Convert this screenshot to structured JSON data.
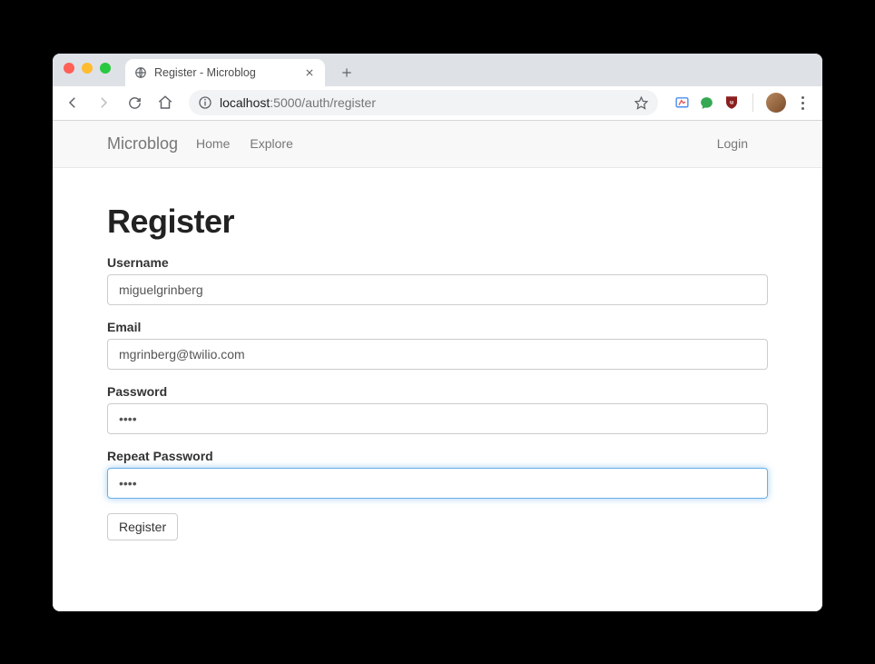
{
  "window": {
    "tab_title": "Register - Microblog"
  },
  "address": {
    "host": "localhost",
    "rest": ":5000/auth/register"
  },
  "navbar": {
    "brand": "Microblog",
    "links": [
      "Home",
      "Explore"
    ],
    "right_link": "Login"
  },
  "page": {
    "heading": "Register",
    "fields": {
      "username": {
        "label": "Username",
        "value": "miguelgrinberg"
      },
      "email": {
        "label": "Email",
        "value": "mgrinberg@twilio.com"
      },
      "password": {
        "label": "Password",
        "value": "••••"
      },
      "repeat_password": {
        "label": "Repeat Password",
        "value": "••••"
      }
    },
    "submit_label": "Register"
  }
}
